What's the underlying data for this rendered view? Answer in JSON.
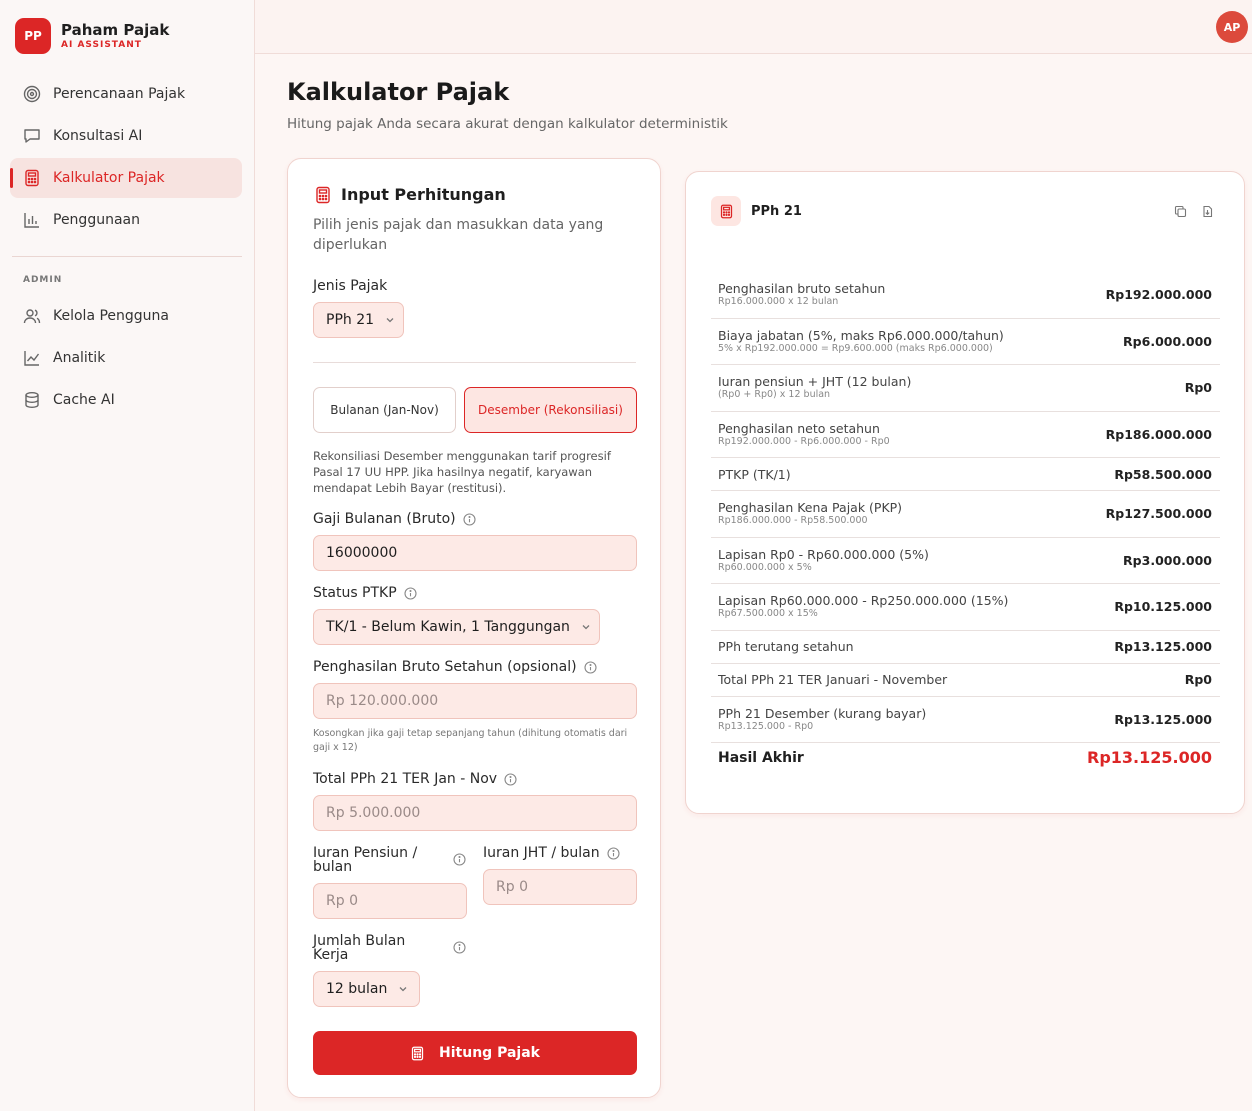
{
  "brand": {
    "logo": "PP",
    "name": "Paham Pajak",
    "sub": "AI ASSISTANT"
  },
  "nav": [
    {
      "label": "Perencanaan Pajak",
      "icon": "target-icon"
    },
    {
      "label": "Konsultasi AI",
      "icon": "chat-icon"
    },
    {
      "label": "Kalkulator Pajak",
      "icon": "calculator-icon",
      "active": true
    },
    {
      "label": "Penggunaan",
      "icon": "bar-chart-icon"
    }
  ],
  "admin": {
    "section": "ADMIN",
    "items": [
      {
        "label": "Kelola Pengguna",
        "icon": "users-icon"
      },
      {
        "label": "Analitik",
        "icon": "line-chart-icon"
      },
      {
        "label": "Cache AI",
        "icon": "database-icon"
      }
    ]
  },
  "topbar": {
    "avatar": "AP"
  },
  "page": {
    "title": "Kalkulator Pajak",
    "subtitle": "Hitung pajak Anda secara akurat dengan kalkulator deterministik"
  },
  "input_card": {
    "title": "Input Perhitungan",
    "desc": "Pilih jenis pajak dan masukkan data yang diperlukan",
    "tax_type_label": "Jenis Pajak",
    "tax_type_value": "PPh 21",
    "mode_monthly": "Bulanan (Jan-Nov)",
    "mode_december": "Desember (Rekonsiliasi)",
    "note": "Rekonsiliasi Desember menggunakan tarif progresif Pasal 17 UU HPP. Jika hasilnya negatif, karyawan mendapat Lebih Bayar (restitusi).",
    "salary_label": "Gaji Bulanan (Bruto)",
    "salary_value": "16000000",
    "ptkp_label": "Status PTKP",
    "ptkp_value": "TK/1 - Belum Kawin, 1 Tanggungan",
    "gross_label": "Penghasilan Bruto Setahun (opsional)",
    "gross_placeholder": "Rp 120.000.000",
    "gross_hint": "Kosongkan jika gaji tetap sepanjang tahun (dihitung otomatis dari gaji x 12)",
    "ter_label": "Total PPh 21 TER Jan - Nov",
    "ter_placeholder": "Rp 5.000.000",
    "pension_label": "Iuran Pensiun / bulan",
    "pension_placeholder": "Rp 0",
    "jht_label": "Iuran JHT / bulan",
    "jht_placeholder": "Rp 0",
    "months_label": "Jumlah Bulan Kerja",
    "months_value": "12 bulan",
    "submit_label": "Hitung Pajak"
  },
  "result": {
    "title": "PPh 21",
    "rows": [
      {
        "label": "Penghasilan bruto setahun",
        "sub": "Rp16.000.000 x 12 bulan",
        "value": "Rp192.000.000"
      },
      {
        "label": "Biaya jabatan (5%, maks Rp6.000.000/tahun)",
        "sub": "5% x Rp192.000.000 = Rp9.600.000 (maks Rp6.000.000)",
        "value": "Rp6.000.000"
      },
      {
        "label": "Iuran pensiun + JHT (12 bulan)",
        "sub": "(Rp0 + Rp0) x 12 bulan",
        "value": "Rp0"
      },
      {
        "label": "Penghasilan neto setahun",
        "sub": "Rp192.000.000 - Rp6.000.000 - Rp0",
        "value": "Rp186.000.000"
      },
      {
        "label": "PTKP (TK/1)",
        "sub": "",
        "value": "Rp58.500.000"
      },
      {
        "label": "Penghasilan Kena Pajak (PKP)",
        "sub": "Rp186.000.000 - Rp58.500.000",
        "value": "Rp127.500.000"
      },
      {
        "label": "Lapisan Rp0 - Rp60.000.000 (5%)",
        "sub": "Rp60.000.000 x 5%",
        "value": "Rp3.000.000"
      },
      {
        "label": "Lapisan Rp60.000.000 - Rp250.000.000 (15%)",
        "sub": "Rp67.500.000 x 15%",
        "value": "Rp10.125.000"
      },
      {
        "label": "PPh terutang setahun",
        "sub": "",
        "value": "Rp13.125.000"
      },
      {
        "label": "Total PPh 21 TER Januari - November",
        "sub": "",
        "value": "Rp0"
      },
      {
        "label": "PPh 21 Desember (kurang bayar)",
        "sub": "Rp13.125.000 - Rp0",
        "value": "Rp13.125.000"
      }
    ],
    "final_label": "Hasil Akhir",
    "final_value": "Rp13.125.000"
  },
  "colors": {
    "accent": "#dc2626",
    "accent_soft": "#fde6e2"
  }
}
